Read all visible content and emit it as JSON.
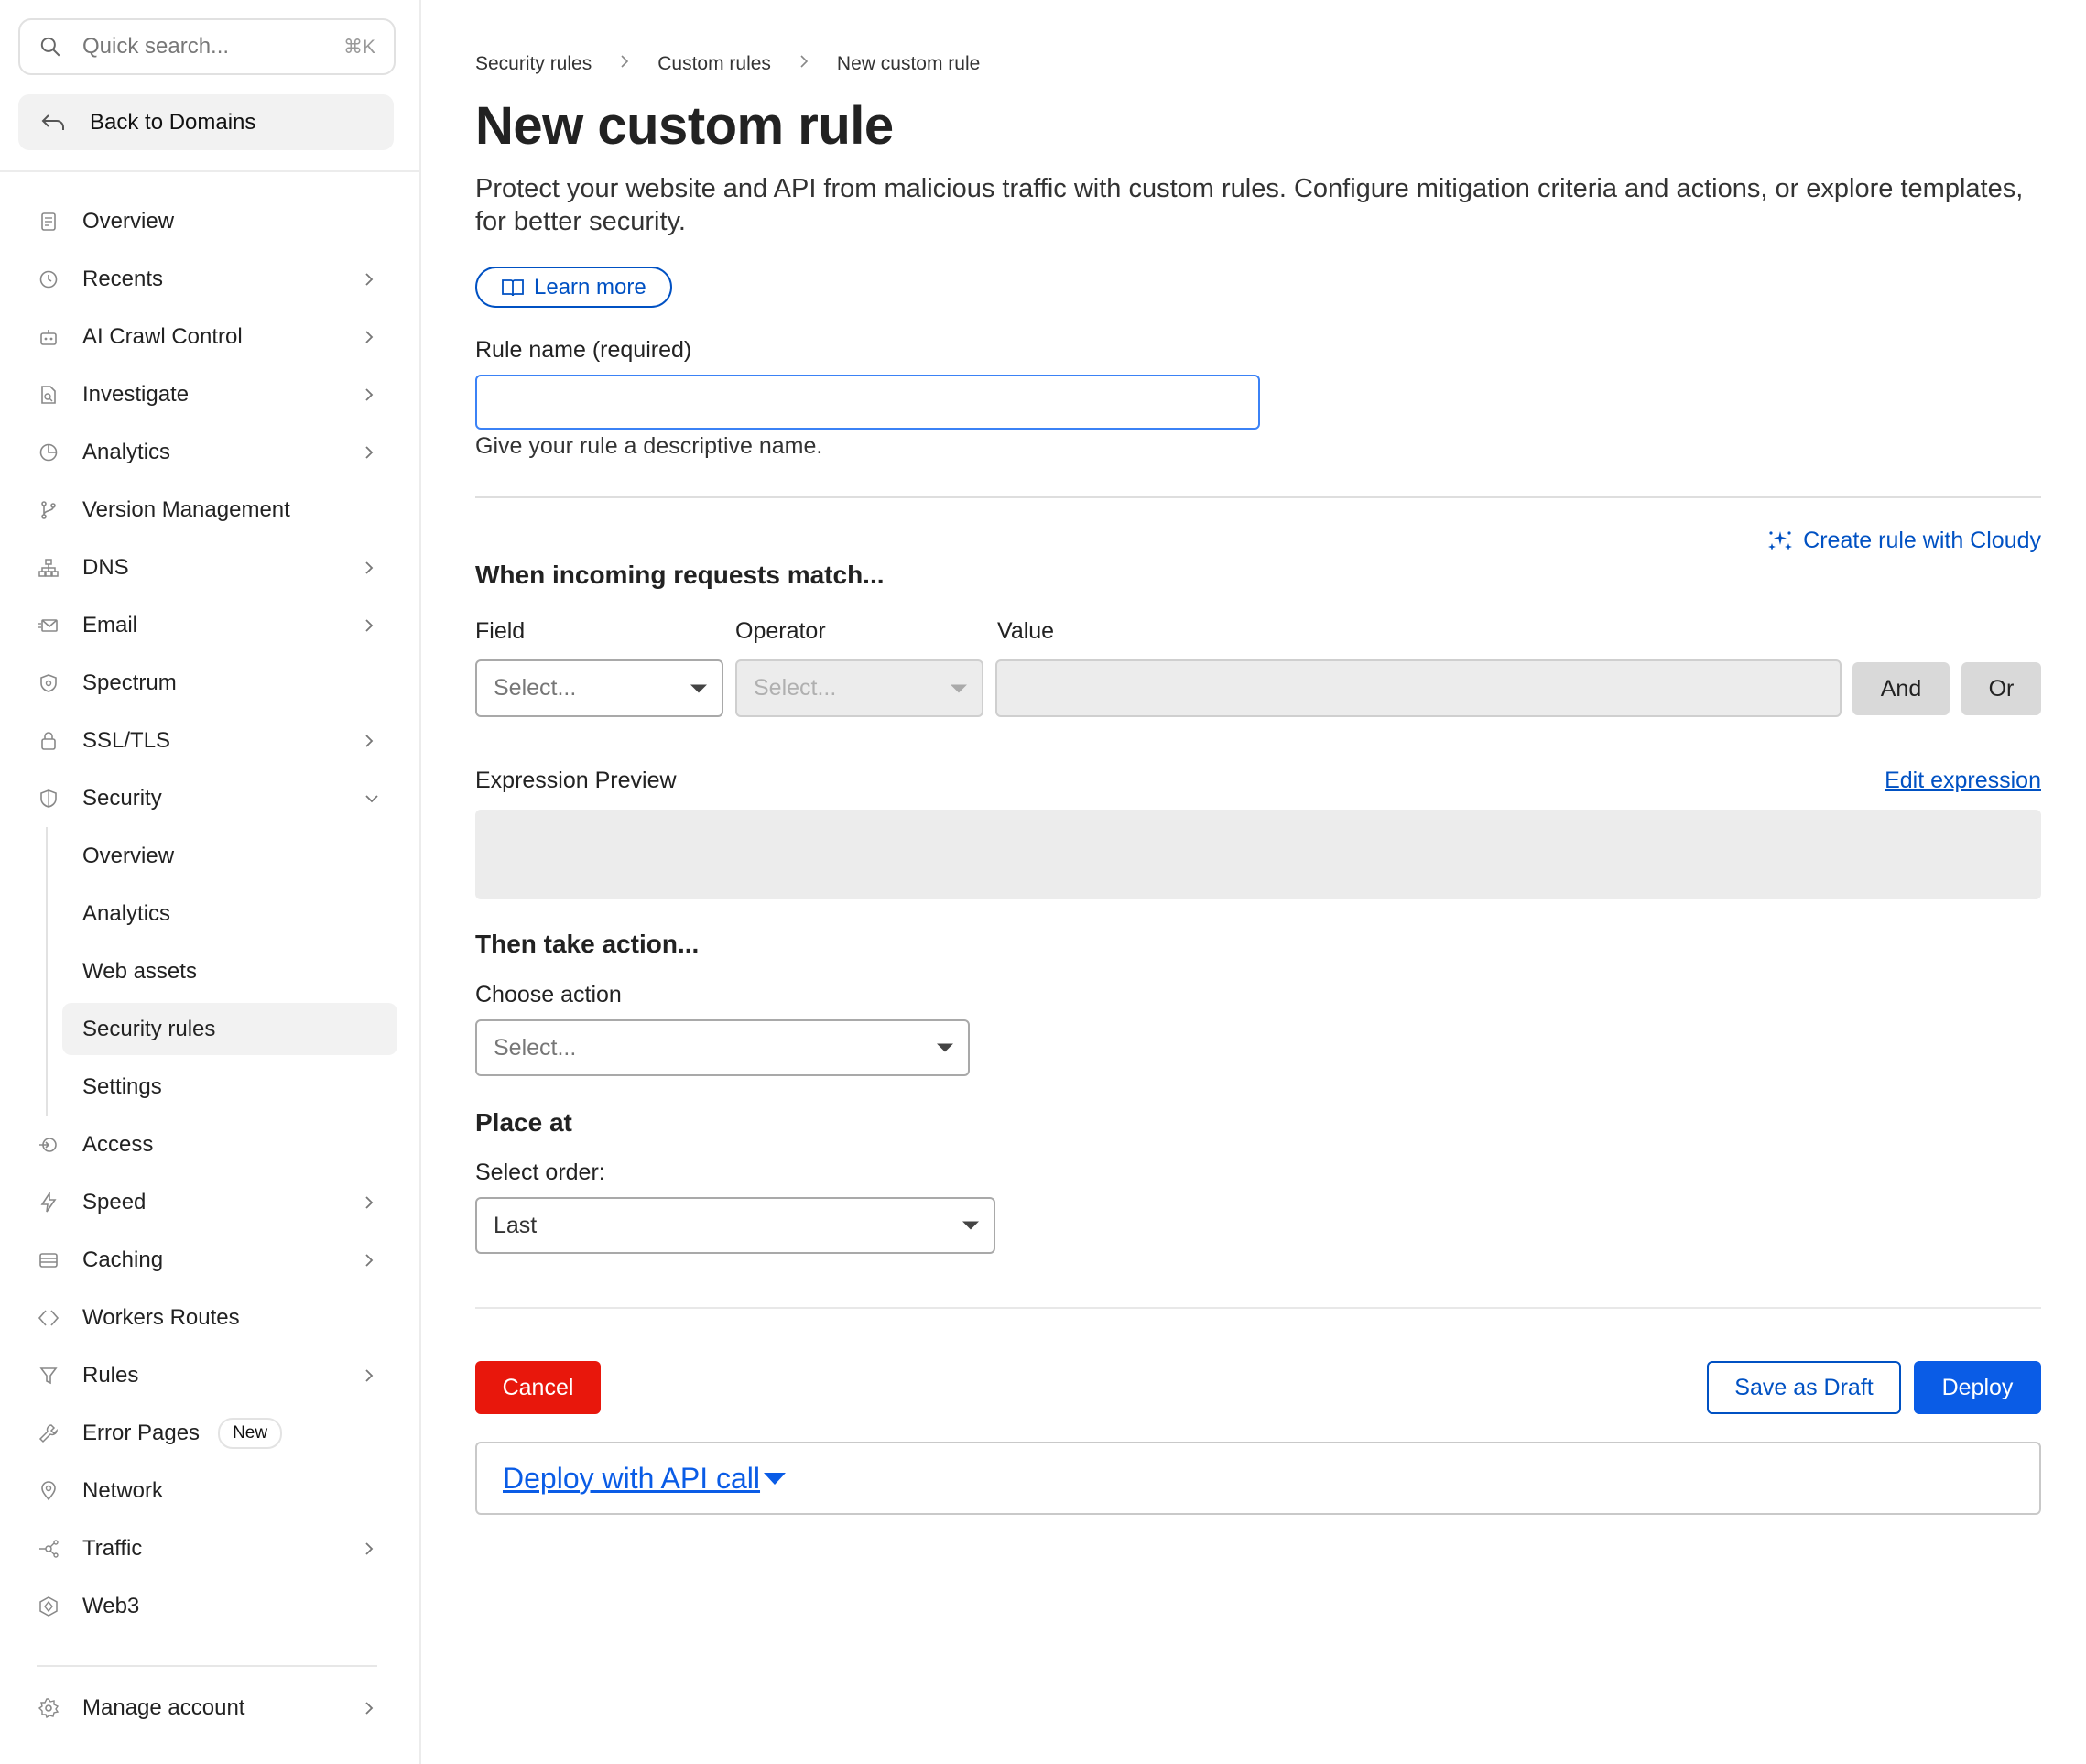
{
  "sidebar": {
    "search": {
      "placeholder": "Quick search...",
      "shortcut": "⌘K"
    },
    "back_label": "Back to Domains",
    "nav": [
      {
        "label": "Overview",
        "icon": "document-icon",
        "chevron": false
      },
      {
        "label": "Recents",
        "icon": "clock-history-icon",
        "chevron": true
      },
      {
        "label": "AI Crawl Control",
        "icon": "robot-icon",
        "chevron": true
      },
      {
        "label": "Investigate",
        "icon": "file-search-icon",
        "chevron": true
      },
      {
        "label": "Analytics",
        "icon": "pie-chart-icon",
        "chevron": true
      },
      {
        "label": "Version Management",
        "icon": "branch-icon",
        "chevron": false
      },
      {
        "label": "DNS",
        "icon": "network-tree-icon",
        "chevron": true
      },
      {
        "label": "Email",
        "icon": "envelope-icon",
        "chevron": true
      },
      {
        "label": "Spectrum",
        "icon": "shield-gear-icon",
        "chevron": false
      },
      {
        "label": "SSL/TLS",
        "icon": "lock-icon",
        "chevron": true
      },
      {
        "label": "Security",
        "icon": "shield-icon",
        "chevron": "down"
      }
    ],
    "security_sub": [
      {
        "label": "Overview",
        "active": false
      },
      {
        "label": "Analytics",
        "active": false
      },
      {
        "label": "Web assets",
        "active": false
      },
      {
        "label": "Security rules",
        "active": true
      },
      {
        "label": "Settings",
        "active": false
      }
    ],
    "nav_after": [
      {
        "label": "Access",
        "icon": "access-icon",
        "chevron": false
      },
      {
        "label": "Speed",
        "icon": "bolt-icon",
        "chevron": true
      },
      {
        "label": "Caching",
        "icon": "server-stack-icon",
        "chevron": true
      },
      {
        "label": "Workers Routes",
        "icon": "code-diamond-icon",
        "chevron": false
      },
      {
        "label": "Rules",
        "icon": "funnel-icon",
        "chevron": true
      },
      {
        "label": "Error Pages",
        "icon": "wrench-icon",
        "chevron": false,
        "badge": "New"
      },
      {
        "label": "Network",
        "icon": "location-pin-icon",
        "chevron": false
      },
      {
        "label": "Traffic",
        "icon": "traffic-nodes-icon",
        "chevron": true
      },
      {
        "label": "Web3",
        "icon": "web3-icon",
        "chevron": false
      }
    ],
    "manage": {
      "label": "Manage account",
      "icon": "gear-icon"
    }
  },
  "breadcrumb": [
    "Security rules",
    "Custom rules",
    "New custom rule"
  ],
  "page": {
    "title": "New custom rule",
    "description": "Protect your website and API from malicious traffic with custom rules. Configure mitigation criteria and actions, or explore templates, for better security.",
    "learn_more": "Learn more"
  },
  "rule_name": {
    "label": "Rule name (required)",
    "value": "",
    "hint": "Give your rule a descriptive name."
  },
  "match": {
    "title": "When incoming requests match...",
    "cloudy_link": "Create rule with Cloudy",
    "field_label": "Field",
    "operator_label": "Operator",
    "value_label": "Value",
    "field_placeholder": "Select...",
    "operator_placeholder": "Select...",
    "and_label": "And",
    "or_label": "Or",
    "preview_label": "Expression Preview",
    "edit_expression": "Edit expression"
  },
  "action": {
    "title": "Then take action...",
    "choose_label": "Choose action",
    "placeholder": "Select..."
  },
  "place": {
    "title": "Place at",
    "order_label": "Select order:",
    "order_value": "Last"
  },
  "footer": {
    "cancel": "Cancel",
    "save_draft": "Save as Draft",
    "deploy": "Deploy",
    "api_link": "Deploy with API call"
  },
  "colors": {
    "accent": "#0051c3",
    "danger": "#e8170c",
    "primary": "#0a5ce6"
  }
}
